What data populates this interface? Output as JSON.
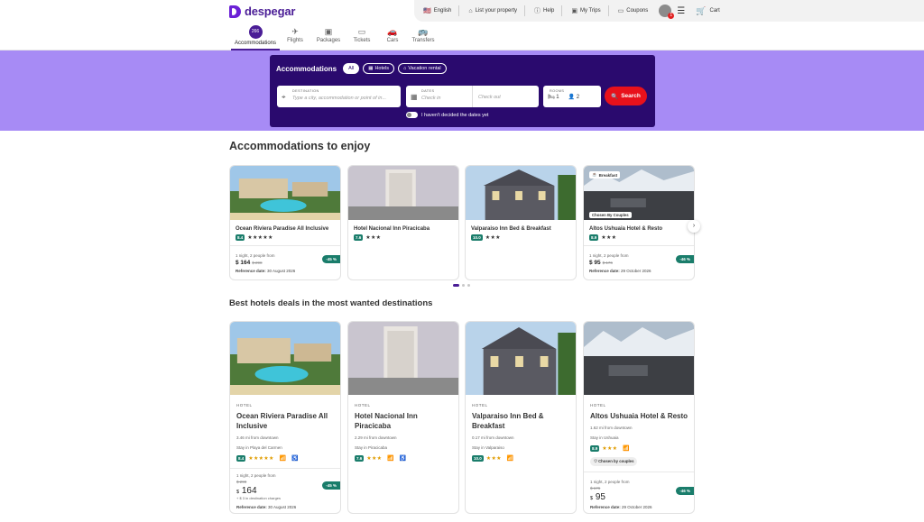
{
  "brand": {
    "name": "despegar",
    "color": "#4a1d96"
  },
  "utility": {
    "language": "English",
    "list_property": "List your property",
    "help": "Help",
    "my_trips": "My Trips",
    "coupons": "Coupons",
    "avatar_badge": "1",
    "cart": "Cart"
  },
  "nav": {
    "tabs": [
      {
        "label": "Accommodations",
        "icon": "bed-icon",
        "glyph": "266"
      },
      {
        "label": "Flights",
        "icon": "plane-icon"
      },
      {
        "label": "Packages",
        "icon": "suitcase-icon"
      },
      {
        "label": "Tickets",
        "icon": "ticket-icon"
      },
      {
        "label": "Cars",
        "icon": "car-icon"
      },
      {
        "label": "Transfers",
        "icon": "bus-icon"
      }
    ]
  },
  "search": {
    "title": "Accommodations",
    "chips": [
      "All",
      "Hotels",
      "Vacation rental"
    ],
    "destination_label": "DESTINATION",
    "destination_placeholder": "Type a city, accommodation or point of in...",
    "dates_label": "DATES",
    "checkin_placeholder": "Check in",
    "checkout_placeholder": "Check out",
    "rooms_label": "ROOMS",
    "rooms_value": "1",
    "people_value": "2",
    "button": "Search",
    "undecided": "I haven't decided the dates yet"
  },
  "section1": {
    "title": "Accommodations to enjoy",
    "cards": [
      {
        "name": "Ocean Riviera Paradise All Inclusive",
        "rating": "8.4",
        "stars": "★★★★★",
        "note": "1 night, 2 people from",
        "price": "$ 164",
        "old_price": "$ 298",
        "discount": "-45 %",
        "ref_label": "Reference date:",
        "ref_date": "30 August 2026"
      },
      {
        "name": "Hotel Nacional Inn Piracicaba",
        "rating": "7.6",
        "stars": "★★★"
      },
      {
        "name": "Valparaiso Inn Bed & Breakfast",
        "rating": "10.0",
        "stars": "★★★"
      },
      {
        "name": "Altos Ushuaia Hotel & Resto",
        "rating": "8.9",
        "stars": "★★★",
        "tag_top": "Breakfast",
        "tag_bottom": "Chosen By Couples",
        "note": "1 night, 2 people from",
        "price": "$ 95",
        "old_price": "$ 176",
        "discount": "-46 %",
        "ref_label": "Reference date:",
        "ref_date": "29 October 2026"
      }
    ]
  },
  "section2": {
    "title": "Best hotels deals in the most wanted destinations",
    "cards": [
      {
        "type": "HOTEL",
        "name": "Ocean Riviera Paradise All Inclusive",
        "distance": "3.46 mi from downtown",
        "city": "Stay in Playa del Carmen",
        "rating": "8.4",
        "stars": "★★★★★",
        "note": "1 night, 2 people from",
        "old_price": "$ 298",
        "currency": "$",
        "price": "164",
        "charges": "+ $ 3 in destination charges",
        "discount": "-45 %",
        "ref_label": "Reference date:",
        "ref_date": "30 August 2026"
      },
      {
        "type": "HOTEL",
        "name": "Hotel Nacional Inn Piracicaba",
        "distance": "2.29 mi from downtown",
        "city": "Stay in Piracicaba",
        "rating": "7.6",
        "stars": "★★★"
      },
      {
        "type": "HOTEL",
        "name": "Valparaiso Inn Bed & Breakfast",
        "distance": "0.17 mi from downtown",
        "city": "Stay in Valparaiso",
        "rating": "10.0",
        "stars": "★★★"
      },
      {
        "type": "HOTEL",
        "name": "Altos Ushuaia Hotel & Resto",
        "distance": "1.62 mi from downtown",
        "city": "Stay in Ushuaia",
        "rating": "8.9",
        "stars": "★★★",
        "couples": "Chosen by couples",
        "note": "1 night, 2 people from",
        "old_price": "$ 176",
        "currency": "$",
        "price": "95",
        "discount": "-46 %",
        "ref_label": "Reference date:",
        "ref_date": "29 October 2026"
      }
    ]
  },
  "colors": {
    "hero": "#a78bf5",
    "search_bg": "#2a0a6e",
    "search_btn": "#e8111b",
    "rating": "#1a7d6b"
  }
}
